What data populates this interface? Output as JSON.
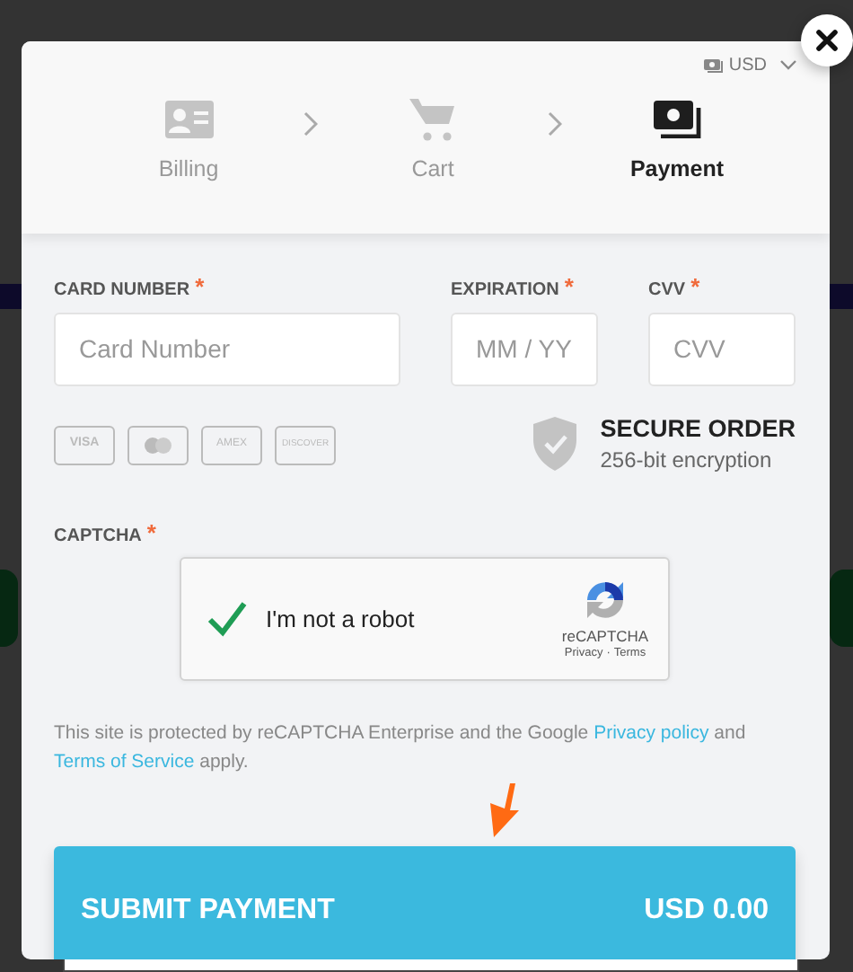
{
  "currency": "USD",
  "steps": [
    {
      "label": "Billing",
      "selected": false
    },
    {
      "label": "Cart",
      "selected": false
    },
    {
      "label": "Payment",
      "selected": true
    }
  ],
  "fields": [
    {
      "label": "CARD NUMBER",
      "required_mark": "*",
      "placeholder": "Card Number",
      "kind": "wide"
    },
    {
      "label": "EXPIRATION",
      "required_mark": "*",
      "placeholder": "MM / YY",
      "kind": "narrow"
    },
    {
      "label": "CVV",
      "required_mark": "*",
      "placeholder": "CVV",
      "kind": "narrow"
    }
  ],
  "card_brands": [
    {
      "kind": "visa",
      "label": "VISA"
    },
    {
      "kind": "mastercard"
    },
    {
      "kind": "amex",
      "label": "AMEX"
    },
    {
      "kind": "discover",
      "label": "DISCOVER"
    }
  ],
  "secure": {
    "title": "SECURE ORDER",
    "subtitle": "256-bit encryption"
  },
  "captcha": {
    "label": "CAPTCHA",
    "required_mark": "*",
    "checked": true,
    "text": "I'm not a robot",
    "brand": "reCAPTCHA",
    "links": [
      "Privacy",
      "Terms"
    ],
    "separator": "·"
  },
  "notice": [
    {
      "kind": "text",
      "text": "This site is protected by reCAPTCHA Enterprise and the Google "
    },
    {
      "kind": "link",
      "text": "Privacy policy"
    },
    {
      "kind": "text",
      "text": " and "
    },
    {
      "kind": "link",
      "text": "Terms of Service"
    },
    {
      "kind": "text",
      "text": " apply."
    }
  ],
  "submit": {
    "label": "SUBMIT PAYMENT",
    "amount": "USD 0.00"
  }
}
